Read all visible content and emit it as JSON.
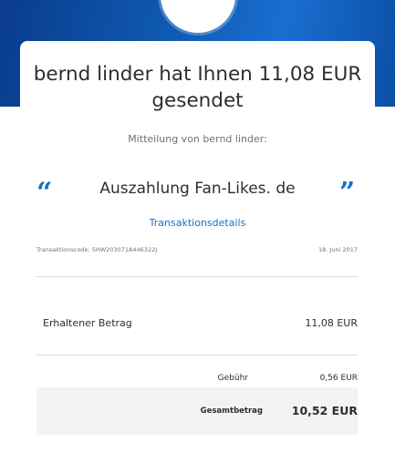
{
  "header": {
    "title": "bernd linder hat Ihnen 11,08 EUR gesendet",
    "accent_color": "#1072c9",
    "band_color": "#0f5cb5"
  },
  "message_section": {
    "label": "Mitteilung von bernd linder:",
    "open_quote": "“",
    "close_quote": "”",
    "text": "Auszahlung Fan-Likes. de"
  },
  "transaction": {
    "details_link": "Transaktionsdetails",
    "code_label": "Transaktionscode: 5HW203071A446322J",
    "date": "18. Juni 2017"
  },
  "summary": {
    "received_label": "Erhaltener Betrag",
    "received_value": "11,08 EUR",
    "fee_label": "Gebühr",
    "fee_value": "0,56 EUR",
    "total_label": "Gesamtbetrag",
    "total_value": "10,52 EUR"
  }
}
